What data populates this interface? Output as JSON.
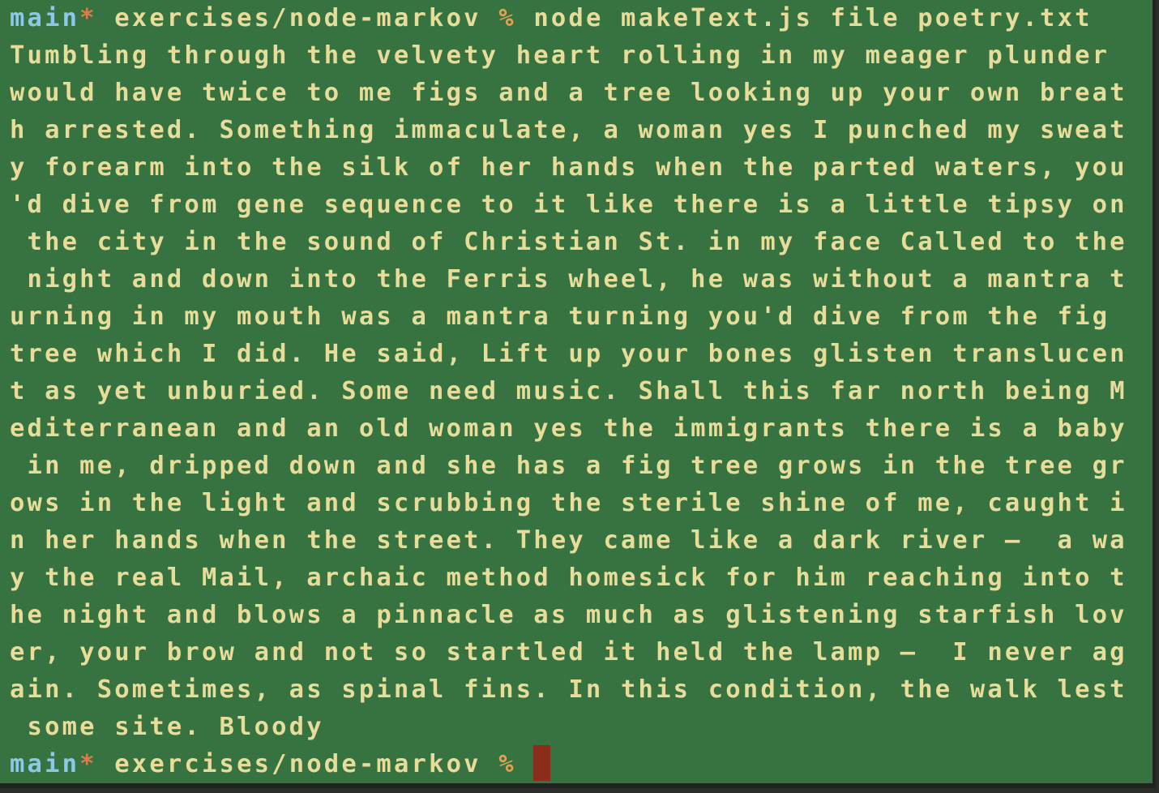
{
  "prompt": {
    "branch": "main",
    "dirty_marker": "*",
    "path": "exercises/node-markov",
    "symbol": "%"
  },
  "command": "node makeText.js file poetry.txt",
  "output_lines": [
    "Tumbling through the velvety heart rolling in my meager plunder",
    "would have twice to me figs and a tree looking up your own breat",
    "h arrested. Something immaculate, a woman yes I punched my sweat",
    "y forearm into the silk of her hands when the parted waters, you",
    "'d dive from gene sequence to it like there is a little tipsy on",
    " the city in the sound of Christian St. in my face Called to the",
    " night and down into the Ferris wheel, he was without a mantra t",
    "urning in my mouth was a mantra turning you'd dive from the fig",
    "tree which I did. He said, Lift up your bones glisten translucen",
    "t as yet unburied. Some need music. Shall this far north being M",
    "editerranean and an old woman yes the immigrants there is a baby",
    " in me, dripped down and she has a fig tree grows in the tree gr",
    "ows in the light and scrubbing the sterile shine of me, caught i",
    "n her hands when the street. They came like a dark river —  a wa",
    "y the real Mail, archaic method homesick for him reaching into t",
    "he night and blows a pinnacle as much as glistening starfish lov",
    "er, your brow and not so startled it held the lamp —  I never ag",
    "ain. Sometimes, as spinal fins. In this condition, the walk lest",
    " some site. Bloody"
  ],
  "colors": {
    "background": "#367340",
    "text": "#e8dc9a",
    "branch": "#8ec8e8",
    "dirty": "#e07a4a",
    "prompt_symbol": "#e0a050",
    "cursor": "#8a2d1a"
  }
}
